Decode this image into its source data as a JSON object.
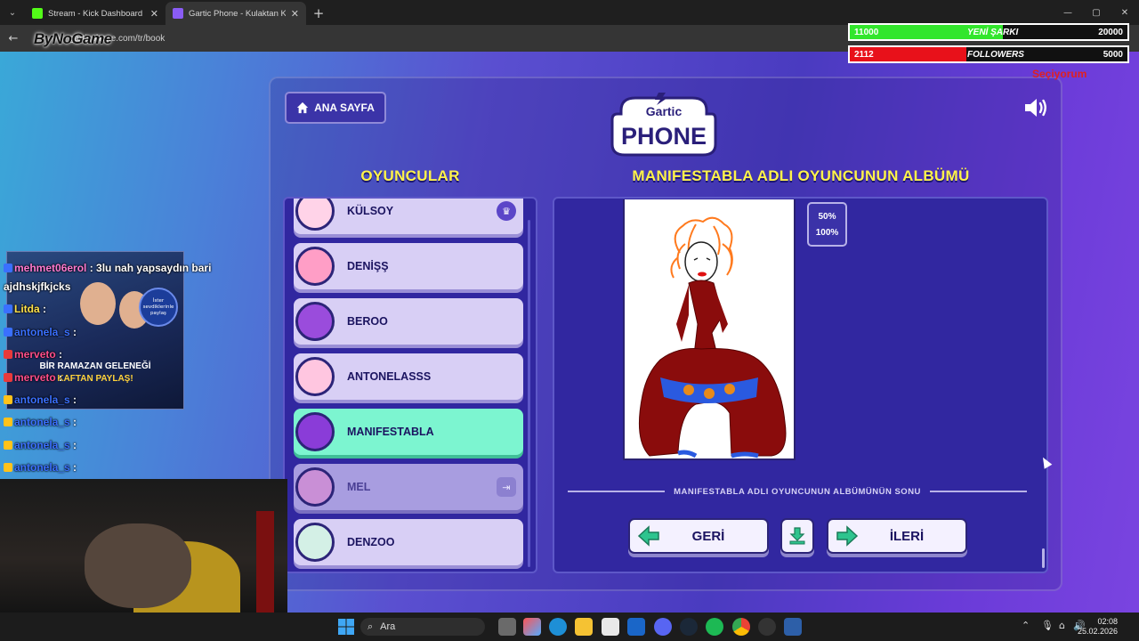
{
  "browser": {
    "tabs": [
      {
        "title": "Stream - Kick Dashboard",
        "active": false,
        "favicon_color": "#53fc18"
      },
      {
        "title": "Gartic Phone - Kulaktan Kulağa",
        "active": true,
        "favicon_color": "#8a5cf5"
      }
    ],
    "url": "garticphone.com/tr/book"
  },
  "overlay": {
    "watermark": "ByNoGame",
    "goal_song": {
      "current": "11000",
      "label": "YENİ ŞARKI",
      "goal": "20000",
      "progress": 0.55,
      "color": "#32e62c"
    },
    "goal_followers": {
      "current": "2112",
      "label": "FOLLOWERS",
      "goal": "5000",
      "progress": 0.42,
      "color": "#e8111a"
    },
    "subscriber_tag": "Seçiyorum"
  },
  "game": {
    "home_label": "ANA SAYFA",
    "logo_top": "Gartic",
    "logo_bottom": "PHONE",
    "players_heading": "OYUNCULAR",
    "album_heading": "MANIFESTABLA ADLI OYUNCUNUN ALBÜMÜ",
    "players": [
      {
        "name": "KÜLSOY",
        "badge": "crown",
        "state": "normal"
      },
      {
        "name": "DENİŞŞ",
        "badge": "",
        "state": "normal"
      },
      {
        "name": "BEROO",
        "badge": "",
        "state": "normal"
      },
      {
        "name": "ANTONELASSS",
        "badge": "",
        "state": "normal"
      },
      {
        "name": "MANIFESTABLA",
        "badge": "",
        "state": "selected"
      },
      {
        "name": "MEL",
        "badge": "exit",
        "state": "dim"
      },
      {
        "name": "DENZOO",
        "badge": "",
        "state": "normal"
      }
    ],
    "zoom_options": [
      "50%",
      "100%"
    ],
    "album_end": "MANIFESTABLA ADLI OYUNCUNUN ALBÜMÜNÜN SONU",
    "back_label": "GERİ",
    "next_label": "İLERİ"
  },
  "chat": {
    "ad_line1": "BİR RAMAZAN GELENEĞİ",
    "ad_line2": "KAFTAN PAYLAŞ!",
    "ad_badge": "İster sevdiklerinle paylaş",
    "messages": [
      {
        "user": "mehmet06erol",
        "text": ": 3lu nah yapsaydın bari",
        "color": "#ff7ad0"
      },
      {
        "user": "",
        "text": "ajdhskjfkjcks",
        "color": "#ffffff"
      },
      {
        "user": "Litda",
        "text": ":",
        "color": "#ffe14a"
      },
      {
        "user": "antonela_s",
        "text": ":",
        "color": "#3a70ff"
      },
      {
        "user": "merveto",
        "text": ":",
        "color": "#ff4e8a"
      },
      {
        "user": "merveto",
        "text": ":",
        "color": "#ff4e8a"
      },
      {
        "user": "antonela_s",
        "text": ":",
        "color": "#3a70ff"
      },
      {
        "user": "antonela_s",
        "text": ":",
        "color": "#3a70ff"
      },
      {
        "user": "antonela_s",
        "text": ":",
        "color": "#3a70ff"
      },
      {
        "user": "antonela_s",
        "text": ":",
        "color": "#3a70ff"
      }
    ]
  },
  "taskbar": {
    "search_label": "Ara",
    "time": "02:08",
    "date": "25.02.2026"
  }
}
